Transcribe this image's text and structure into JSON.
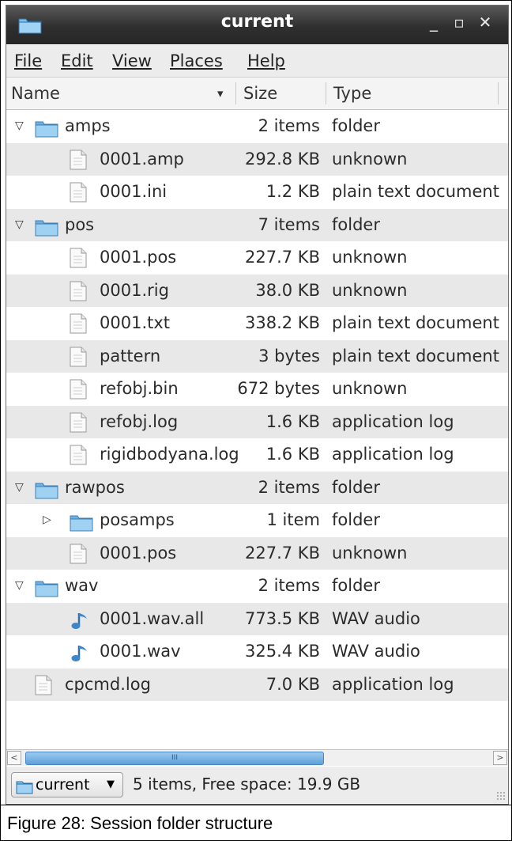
{
  "window": {
    "title": "current"
  },
  "menu": {
    "file": "File",
    "edit": "Edit",
    "view": "View",
    "places": "Places",
    "help": "Help"
  },
  "columns": {
    "name": "Name",
    "size": "Size",
    "type": "Type"
  },
  "rows": [
    {
      "name": "amps",
      "size": "2 items",
      "type": "folder",
      "icon": "folder-icon",
      "level": 0,
      "expander": "expanded"
    },
    {
      "name": "0001.amp",
      "size": "292.8 KB",
      "type": "unknown",
      "icon": "file-icon",
      "level": 1
    },
    {
      "name": "0001.ini",
      "size": "1.2 KB",
      "type": "plain text document",
      "icon": "file-icon",
      "level": 1
    },
    {
      "name": "pos",
      "size": "7 items",
      "type": "folder",
      "icon": "folder-icon",
      "level": 0,
      "expander": "expanded"
    },
    {
      "name": "0001.pos",
      "size": "227.7 KB",
      "type": "unknown",
      "icon": "file-icon",
      "level": 1
    },
    {
      "name": "0001.rig",
      "size": "38.0 KB",
      "type": "unknown",
      "icon": "file-icon",
      "level": 1
    },
    {
      "name": "0001.txt",
      "size": "338.2 KB",
      "type": "plain text document",
      "icon": "file-icon",
      "level": 1
    },
    {
      "name": "pattern",
      "size": "3 bytes",
      "type": "plain text document",
      "icon": "file-icon",
      "level": 1
    },
    {
      "name": "refobj.bin",
      "size": "672 bytes",
      "type": "unknown",
      "icon": "file-icon",
      "level": 1
    },
    {
      "name": "refobj.log",
      "size": "1.6 KB",
      "type": "application log",
      "icon": "file-icon",
      "level": 1
    },
    {
      "name": "rigidbodyana.log",
      "size": "1.6 KB",
      "type": "application log",
      "icon": "file-icon",
      "level": 1
    },
    {
      "name": "rawpos",
      "size": "2 items",
      "type": "folder",
      "icon": "folder-icon",
      "level": 0,
      "expander": "expanded"
    },
    {
      "name": "posamps",
      "size": "1 item",
      "type": "folder",
      "icon": "folder-icon",
      "level": 1,
      "expander": "collapsed"
    },
    {
      "name": "0001.pos",
      "size": "227.7 KB",
      "type": "unknown",
      "icon": "file-icon",
      "level": 1
    },
    {
      "name": "wav",
      "size": "2 items",
      "type": "folder",
      "icon": "folder-icon",
      "level": 0,
      "expander": "expanded"
    },
    {
      "name": "0001.wav.all",
      "size": "773.5 KB",
      "type": "WAV audio",
      "icon": "audio-icon",
      "level": 1
    },
    {
      "name": "0001.wav",
      "size": "325.4 KB",
      "type": "WAV audio",
      "icon": "audio-icon",
      "level": 1
    },
    {
      "name": "cpcmd.log",
      "size": "7.0 KB",
      "type": "application log",
      "icon": "file-icon",
      "level": 0
    }
  ],
  "statusbar": {
    "location": "current",
    "status": "5 items, Free space: 19.9 GB"
  },
  "caption": "Figure 28:   Session folder structure",
  "colors": {
    "folder": "#74b7e6",
    "titlebar": "#2f2f2f",
    "row_alt": "#e8e8e8",
    "scroll_thumb": "#5ea1d9"
  }
}
